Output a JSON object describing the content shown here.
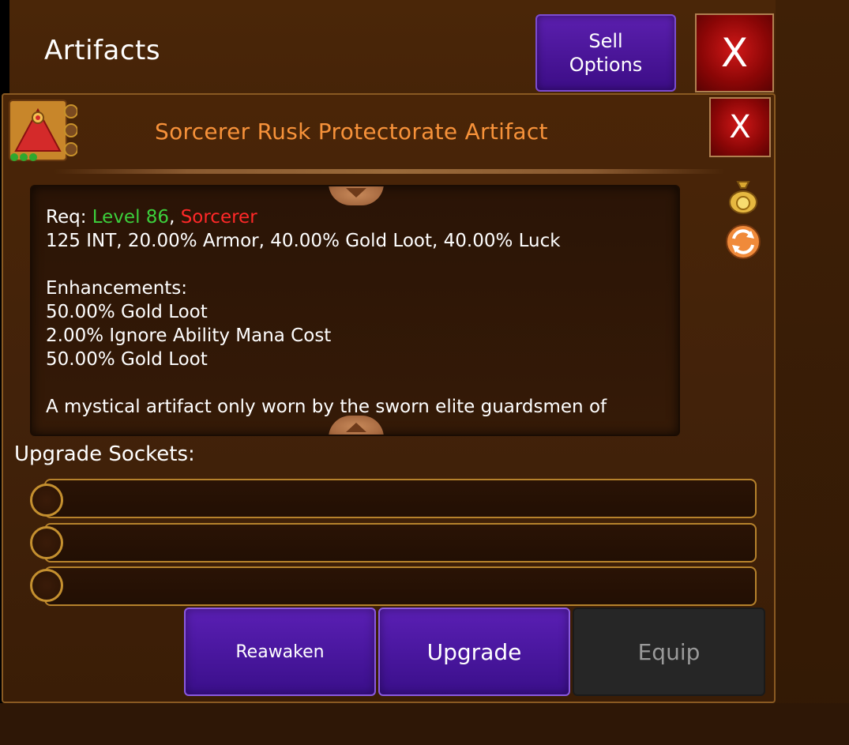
{
  "header": {
    "title": "Artifacts",
    "sell_options_line1": "Sell",
    "sell_options_line2": "Options",
    "close_label": "X"
  },
  "dialog": {
    "title": "Sorcerer Rusk Protectorate Artifact",
    "close_label": "X",
    "req_prefix": "Req: ",
    "req_level": "Level 86",
    "req_separator": ", ",
    "req_class": "Sorcerer",
    "stats": "125 INT, 20.00% Armor, 40.00% Gold Loot, 40.00% Luck",
    "enhancements_title": "Enhancements:",
    "enhancements": [
      "50.00% Gold Loot",
      "2.00% Ignore Ability Mana Cost",
      "50.00% Gold Loot"
    ],
    "description": "A mystical artifact only worn by the sworn elite guardsmen of"
  },
  "sockets": {
    "label": "Upgrade Sockets:",
    "count": 3
  },
  "actions": {
    "reawaken": "Reawaken",
    "upgrade": "Upgrade",
    "equip": "Equip"
  },
  "colors": {
    "title_orange": "#f7923a",
    "level_green": "#3ccf3c",
    "class_red": "#ff2828",
    "button_purple": "#4a17a0",
    "equip_disabled": "#262626"
  },
  "icons": {
    "artifact": "triangle-artifact-icon",
    "sell": "moneybag-icon",
    "swap": "swap-arrows-icon"
  }
}
